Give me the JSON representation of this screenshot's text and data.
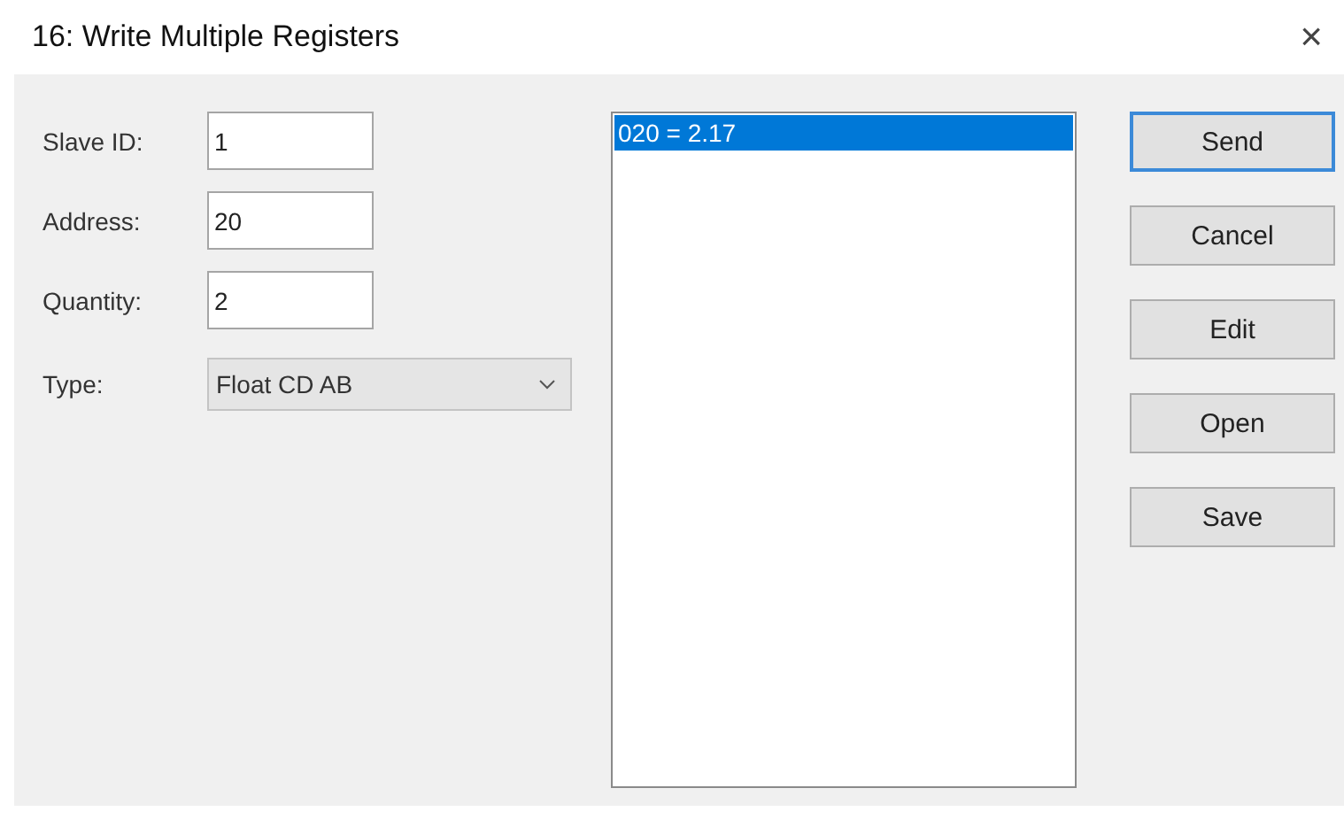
{
  "window": {
    "title": "16: Write Multiple Registers",
    "close": "×"
  },
  "fields": [
    {
      "label": "Slave ID:",
      "value": "1"
    },
    {
      "label": "Address:",
      "value": "20"
    },
    {
      "label": "Quantity:",
      "value": "2"
    }
  ],
  "type": {
    "label": "Type:",
    "value": "Float CD AB"
  },
  "list": [
    {
      "text": "020 = 2.17",
      "selected": true
    }
  ],
  "buttons": [
    {
      "label": "Send",
      "default": true
    },
    {
      "label": "Cancel",
      "default": false
    },
    {
      "label": "Edit",
      "default": false
    },
    {
      "label": "Open",
      "default": false
    },
    {
      "label": "Save",
      "default": false
    }
  ]
}
